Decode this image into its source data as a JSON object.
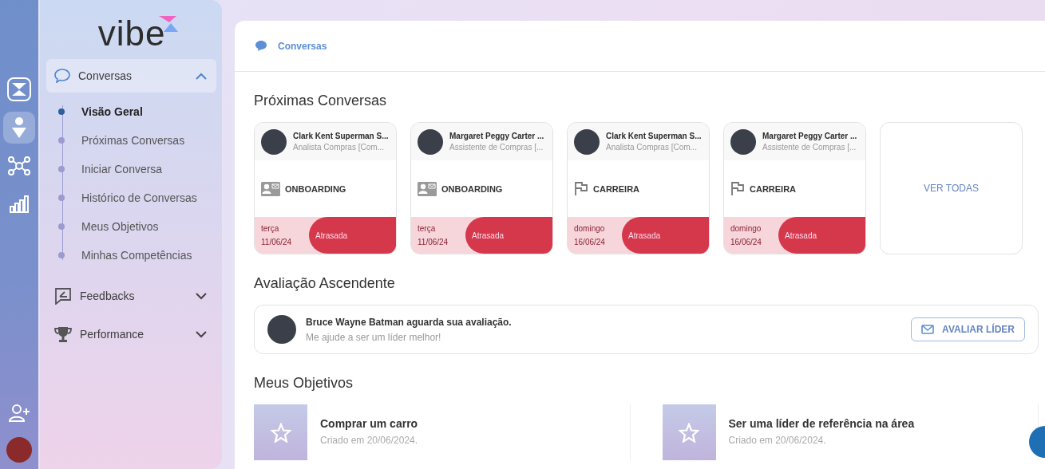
{
  "rail": [
    {
      "kind": "logo",
      "selected": false
    },
    {
      "kind": "ai",
      "selected": true
    },
    {
      "kind": "network",
      "selected": false
    },
    {
      "kind": "chart",
      "selected": false
    }
  ],
  "rail_bottom": [
    {
      "kind": "add-user"
    },
    {
      "kind": "avatar"
    }
  ],
  "logo": {
    "text": "vibe"
  },
  "nav": [
    {
      "label": "Conversas",
      "expanded": true,
      "children": [
        {
          "label": "Visão Geral",
          "selected": true
        },
        {
          "label": "Próximas Conversas",
          "selected": false
        },
        {
          "label": "Iniciar Conversa",
          "selected": false
        },
        {
          "label": "Histórico de Conversas",
          "selected": false
        },
        {
          "label": "Meus Objetivos",
          "selected": false
        },
        {
          "label": "Minhas Competências",
          "selected": false
        }
      ]
    },
    {
      "label": "Feedbacks",
      "expanded": false
    },
    {
      "label": "Performance",
      "expanded": false
    }
  ],
  "breadcrumb": "Conversas",
  "upcoming": {
    "title": "Próximas Conversas",
    "cards": [
      {
        "name": "Clark Kent Superman S...",
        "role": "Analista Compras [Com...",
        "kind": "onboarding",
        "category": "ONBOARDING",
        "day": "terça",
        "date": "11/06/24",
        "status": "Atrasada"
      },
      {
        "name": "Margaret Peggy Carter ...",
        "role": "Assistente de Compras [...",
        "kind": "onboarding",
        "category": "ONBOARDING",
        "day": "terça",
        "date": "11/06/24",
        "status": "Atrasada"
      },
      {
        "name": "Clark Kent Superman S...",
        "role": "Analista Compras [Com...",
        "kind": "carreira",
        "category": "CARREIRA",
        "day": "domingo",
        "date": "16/06/24",
        "status": "Atrasada"
      },
      {
        "name": "Margaret Peggy Carter ...",
        "role": "Assistente de Compras [...",
        "kind": "carreira",
        "category": "CARREIRA",
        "day": "domingo",
        "date": "16/06/24",
        "status": "Atrasada"
      }
    ],
    "see_all": "VER TODAS"
  },
  "upward": {
    "title": "Avaliação Ascendente",
    "message": "Bruce Wayne Batman aguarda sua avaliação.",
    "subtitle": "Me ajude a ser um líder melhor!",
    "button": "AVALIAR LÍDER"
  },
  "objectives": {
    "title": "Meus Objetivos",
    "items": [
      {
        "title": "Comprar um carro",
        "created": "Criado em 20/06/2024."
      },
      {
        "title": "Ser uma líder de referência na área",
        "created": "Criado em 20/06/2024."
      }
    ]
  }
}
